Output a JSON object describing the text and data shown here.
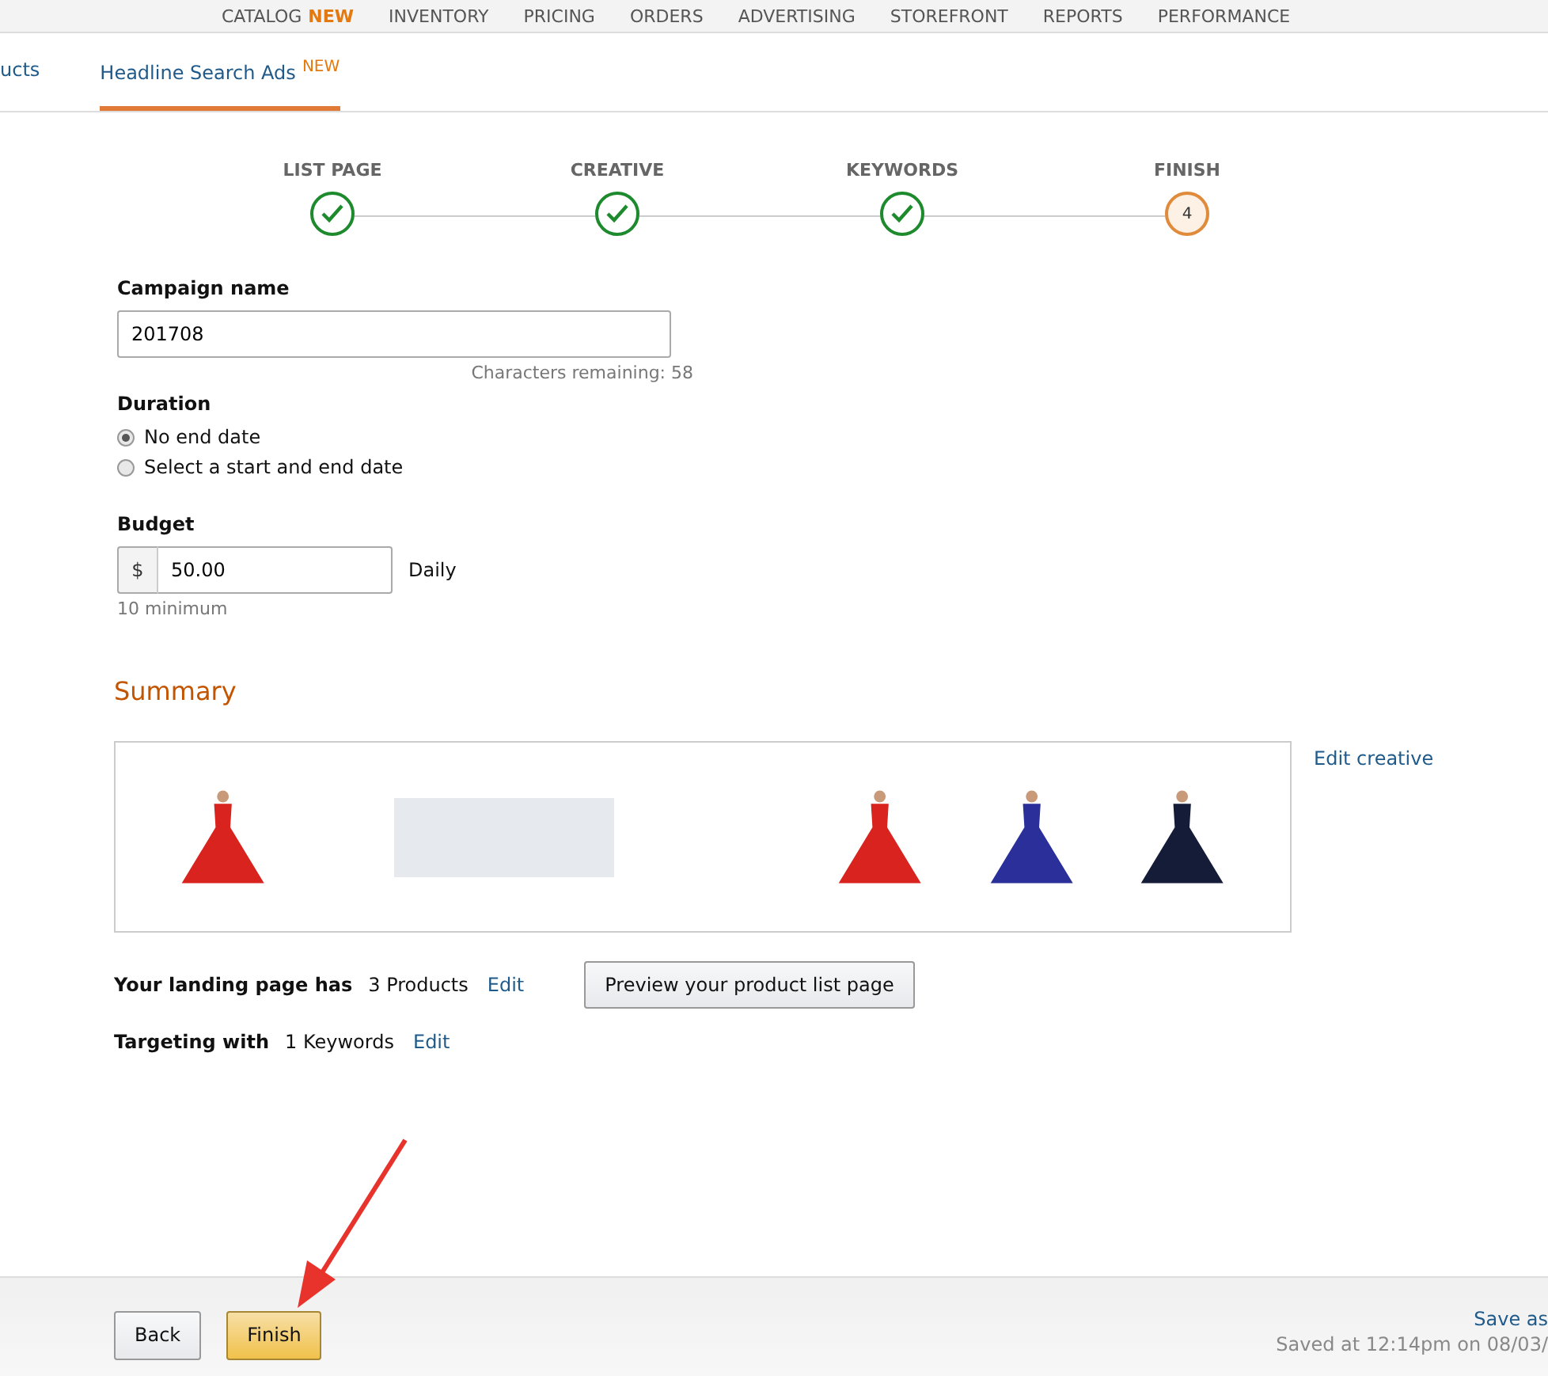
{
  "top_nav": [
    {
      "label": "CATALOG",
      "badge": "NEW"
    },
    {
      "label": "INVENTORY"
    },
    {
      "label": "PRICING"
    },
    {
      "label": "ORDERS"
    },
    {
      "label": "ADVERTISING"
    },
    {
      "label": "STOREFRONT"
    },
    {
      "label": "REPORTS"
    },
    {
      "label": "PERFORMANCE"
    }
  ],
  "tabs": [
    {
      "label": "ucts",
      "selected": false
    },
    {
      "label": "Headline Search Ads",
      "badge": "NEW",
      "selected": true
    }
  ],
  "steps": [
    {
      "label": "LIST PAGE",
      "completed": true
    },
    {
      "label": "CREATIVE",
      "completed": true
    },
    {
      "label": "KEYWORDS",
      "completed": true
    },
    {
      "label": "FINISH",
      "completed": false,
      "number": "4"
    }
  ],
  "campaign_name": {
    "label": "Campaign name",
    "value": "201708",
    "hint": "Characters remaining: 58"
  },
  "duration": {
    "label": "Duration",
    "options": [
      {
        "label": "No end date",
        "selected": true
      },
      {
        "label": "Select a start and end date",
        "selected": false
      }
    ]
  },
  "budget": {
    "label": "Budget",
    "currency": "$",
    "value": "50.00",
    "period": "Daily",
    "hint": "10 minimum"
  },
  "summary": {
    "title": "Summary",
    "edit_link": "Edit creative",
    "products": [
      {
        "color": "#d8231e"
      },
      {
        "color": "#2a2f9a"
      },
      {
        "color": "#141c38"
      }
    ],
    "rows": [
      {
        "label": "Your landing page has",
        "value": "3 Products",
        "link": "Edit",
        "button": "Preview your product list page"
      },
      {
        "label": "Targeting with",
        "value": "1 Keywords",
        "link": "Edit"
      }
    ]
  },
  "footer": {
    "back": "Back",
    "finish": "Finish",
    "save_link": "Save as",
    "saved": "Saved at 12:14pm on 08/03/"
  }
}
